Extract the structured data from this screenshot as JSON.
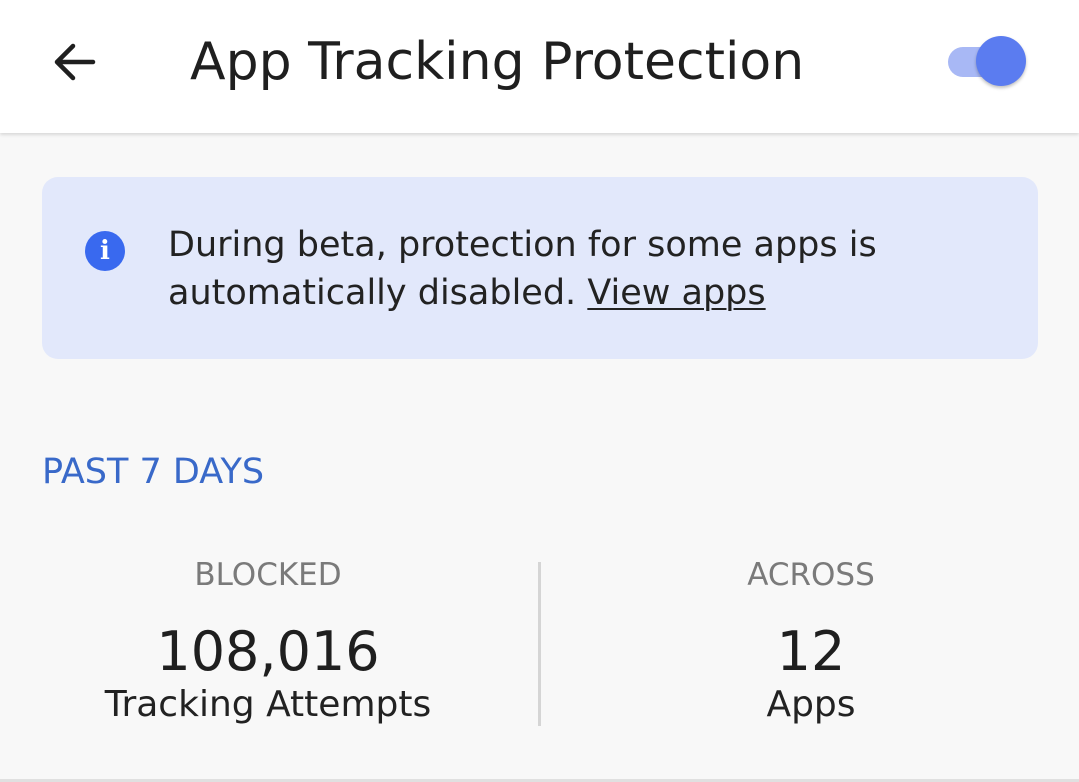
{
  "header": {
    "title": "App Tracking Protection",
    "back_icon": "arrow-left-icon",
    "toggle_on": true
  },
  "info_card": {
    "icon": "info-icon",
    "icon_glyph": "i",
    "text": "During beta, protection for some apps is automatically disabled.",
    "link_label": "View apps"
  },
  "section": {
    "title": "PAST 7 DAYS"
  },
  "stats": {
    "blocked": {
      "label": "BLOCKED",
      "value": "108,016",
      "caption": "Tracking Attempts"
    },
    "across": {
      "label": "ACROSS",
      "value": "12",
      "caption": "Apps"
    }
  },
  "colors": {
    "accent": "#3969ef",
    "toggle_thumb": "#5b7cf0",
    "toggle_track": "#a8b8f5",
    "info_background": "#e2e8fb",
    "section_header": "#3969c9"
  }
}
